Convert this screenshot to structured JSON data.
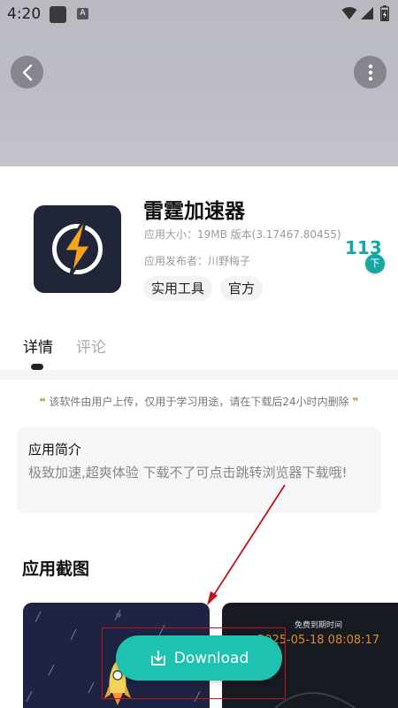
{
  "status": {
    "time": "4:20",
    "a_label": "A"
  },
  "app": {
    "title": "雷霆加速器",
    "meta_size": "应用大小：19MB 版本(3.17467.80455)",
    "meta_publisher": "应用发布者：川野梅子",
    "tags": [
      "实用工具",
      "官方"
    ],
    "download_count": "113",
    "download_badge": "下"
  },
  "tabs": [
    {
      "label": "详情",
      "active": true
    },
    {
      "label": "评论",
      "active": false
    }
  ],
  "notice": {
    "quote_left": "❝",
    "text": "该软件由用户上传，仅用于学习用途，请在下载后24小时内删除",
    "quote_right": "❞"
  },
  "intro": {
    "title": "应用简介",
    "text": "极致加速,超爽体验 下载不了可点击跳转浏览器下载哦!"
  },
  "screenshots": {
    "title": "应用截图",
    "shot2_label": "免费到期时间",
    "shot2_date": "2025-05-18 08:08:17"
  },
  "download_button": {
    "label": "Download"
  },
  "colors": {
    "accent": "#1fc1b0",
    "teal_text": "#12a8a4",
    "annotation": "#c0141b",
    "banner": "#bcbdc5"
  },
  "icons": [
    "back-icon",
    "more-icon",
    "wifi-icon",
    "signal-icon",
    "battery-icon",
    "lightning-logo-icon",
    "download-icon",
    "rocket-icon"
  ]
}
